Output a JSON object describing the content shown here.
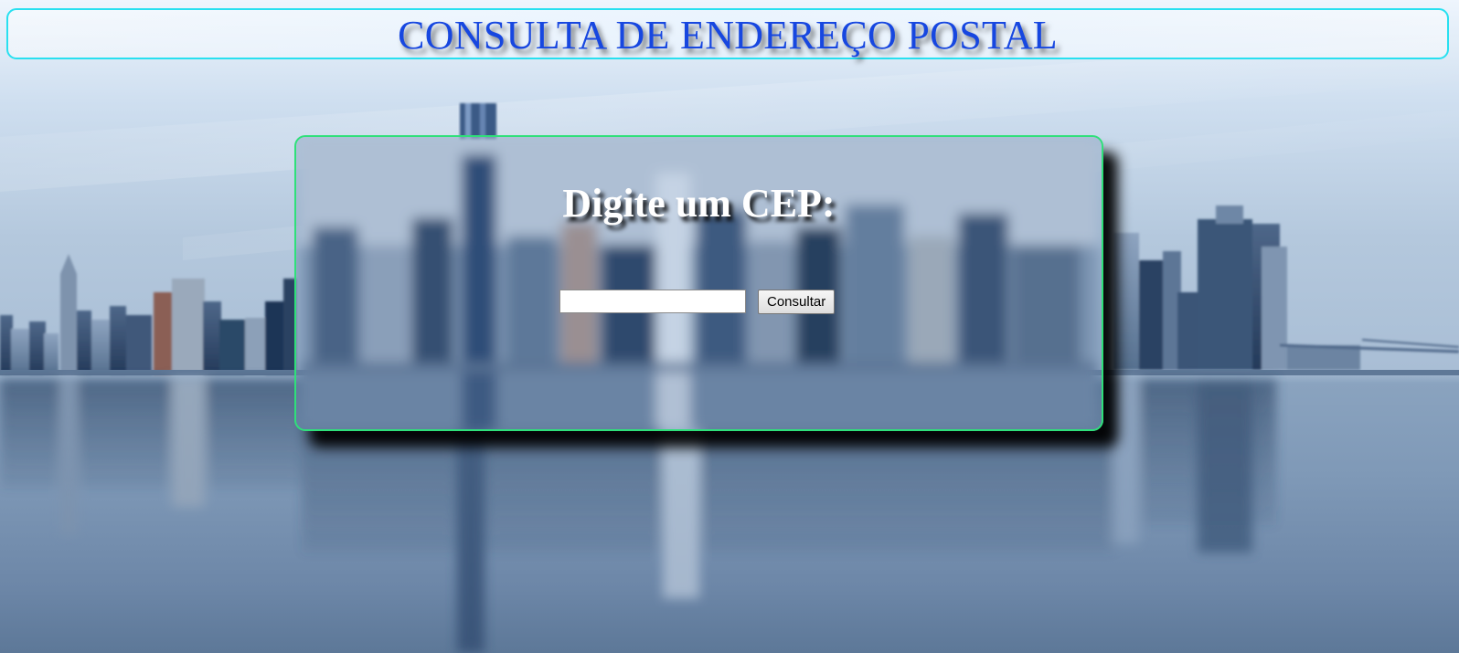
{
  "header": {
    "title": "CONSULTA DE ENDEREÇO POSTAL"
  },
  "form": {
    "heading": "Digite um CEP:",
    "cep_input": {
      "value": "",
      "placeholder": ""
    },
    "submit_label": "Consultar"
  },
  "colors": {
    "title_text": "#1747e0",
    "banner_border": "#28e0f0",
    "card_border": "#2fe07a",
    "heading_text": "#ffffff"
  },
  "background": {
    "subject": "city-skyline-reflection"
  }
}
